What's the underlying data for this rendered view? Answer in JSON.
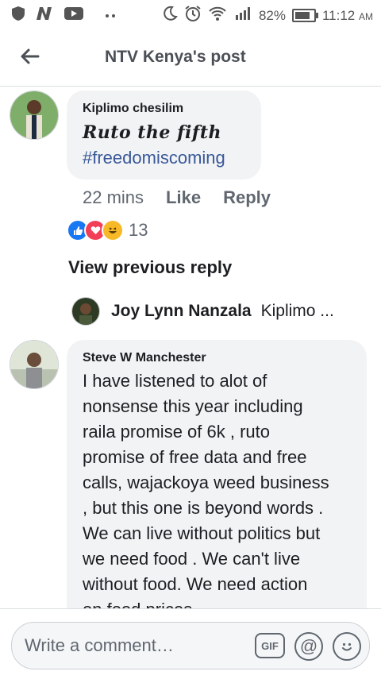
{
  "status_bar": {
    "battery": "82%",
    "battery_level": 0.82,
    "time": "11:12",
    "ampm": "AM",
    "icons": [
      "shield-icon",
      "n-app-icon",
      "youtube-icon",
      "dots-icon",
      "moon-icon",
      "alarm-icon",
      "wifi-icon",
      "signal-icon",
      "battery-icon"
    ]
  },
  "header": {
    "title": "NTV Kenya's post"
  },
  "comment1": {
    "author": "Kiplimo chesilim",
    "line1": "Ruto the fifth",
    "hashtag": "#freedomiscoming",
    "time": "22 mins",
    "like": "Like",
    "reply": "Reply",
    "reaction_count": "13",
    "reactions": [
      "like",
      "love",
      "haha"
    ]
  },
  "view_previous": "View previous reply",
  "reply_preview": {
    "name": "Joy Lynn Nanzala",
    "snippet": "Kiplimo ..."
  },
  "comment2": {
    "author": "Steve W Manchester",
    "lines": [
      "I have listened to alot of",
      "nonsense this year including",
      "raila promise of 6k , ruto",
      "promise of free data and free",
      "calls, wajackoya weed business",
      ", but this one is beyond words .",
      "We can live without politics but",
      "we need food . We can't live",
      "without food. We need action",
      "on food prices."
    ]
  },
  "composer": {
    "placeholder": "Write a comment…",
    "gif_label": "GIF",
    "at_label": "@"
  },
  "colors": {
    "link": "#385898",
    "like_blue": "#1877f2",
    "love_red": "#f33e58",
    "haha_yellow": "#f7b928"
  }
}
